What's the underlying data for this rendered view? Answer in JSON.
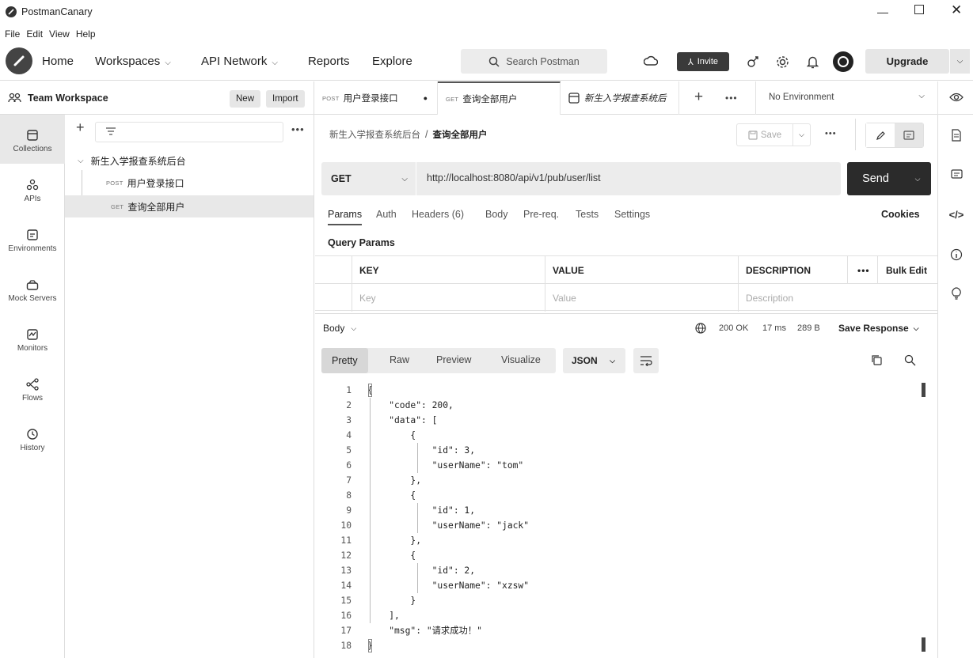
{
  "app": {
    "title": "PostmanCanary",
    "menu": [
      "File",
      "Edit",
      "View",
      "Help"
    ]
  },
  "header": {
    "nav": [
      "Home",
      "Workspaces",
      "API Network",
      "Reports",
      "Explore"
    ],
    "search_placeholder": "Search Postman",
    "invite_label": "Invite",
    "upgrade_label": "Upgrade"
  },
  "workspace": {
    "name": "Team Workspace",
    "new_label": "New",
    "import_label": "Import"
  },
  "left_rail": [
    {
      "label": "Collections",
      "icon": "collections-icon"
    },
    {
      "label": "APIs",
      "icon": "apis-icon"
    },
    {
      "label": "Environments",
      "icon": "environments-icon"
    },
    {
      "label": "Mock Servers",
      "icon": "mock-servers-icon"
    },
    {
      "label": "Monitors",
      "icon": "monitors-icon"
    },
    {
      "label": "Flows",
      "icon": "flows-icon"
    },
    {
      "label": "History",
      "icon": "history-icon"
    }
  ],
  "collection": {
    "name": "新生入学报查系统后台",
    "requests": [
      {
        "method": "POST",
        "name": "用户登录接口"
      },
      {
        "method": "GET",
        "name": "查询全部用户"
      }
    ]
  },
  "tabs": [
    {
      "method": "POST",
      "name": "用户登录接口"
    },
    {
      "method": "GET",
      "name": "查询全部用户"
    },
    {
      "name": "新生入学报查系统后"
    }
  ],
  "environment": "No Environment",
  "request": {
    "breadcrumb_parent": "新生入学报查系统后台",
    "breadcrumb_sep": "/",
    "breadcrumb_current": "查询全部用户",
    "save_label": "Save",
    "method": "GET",
    "url": "http://localhost:8080/api/v1/pub/user/list",
    "send_label": "Send",
    "tabs": [
      "Params",
      "Auth",
      "Headers (6)",
      "Body",
      "Pre-req.",
      "Tests",
      "Settings"
    ],
    "cookies_label": "Cookies",
    "query_params_title": "Query Params",
    "param_headers": [
      "KEY",
      "VALUE",
      "DESCRIPTION"
    ],
    "bulk_edit_label": "Bulk Edit",
    "param_placeholders": [
      "Key",
      "Value",
      "Description"
    ]
  },
  "response": {
    "body_label": "Body",
    "status": "200 OK",
    "time": "17 ms",
    "size": "289 B",
    "save_response_label": "Save Response",
    "view_tabs": [
      "Pretty",
      "Raw",
      "Preview",
      "Visualize"
    ],
    "format": "JSON",
    "lines": [
      "{",
      "    \"code\": 200,",
      "    \"data\": [",
      "        {",
      "            \"id\": 3,",
      "            \"userName\": \"tom\"",
      "        },",
      "        {",
      "            \"id\": 1,",
      "            \"userName\": \"jack\"",
      "        },",
      "        {",
      "            \"id\": 2,",
      "            \"userName\": \"xzsw\"",
      "        }",
      "    ],",
      "    \"msg\": \"请求成功！\"",
      "}"
    ]
  }
}
